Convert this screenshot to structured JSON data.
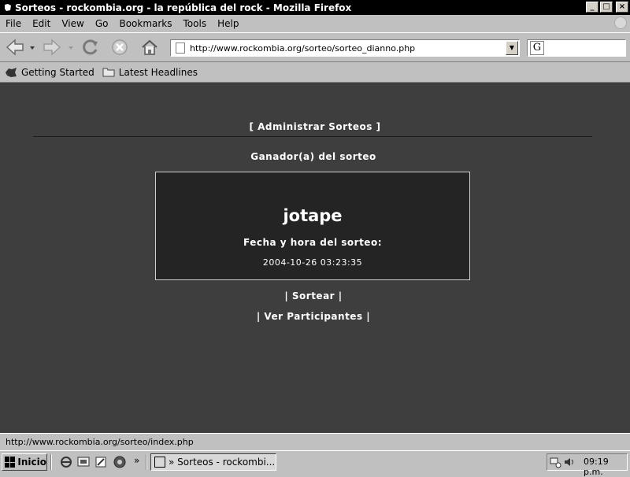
{
  "window": {
    "title": "Sorteos - rockombia.org - la república del rock - Mozilla Firefox",
    "app_glyph": "» ",
    "controls": {
      "minimize": "_",
      "maximize": "□",
      "close": "×"
    }
  },
  "menu": [
    {
      "label": "File"
    },
    {
      "label": "Edit"
    },
    {
      "label": "View"
    },
    {
      "label": "Go"
    },
    {
      "label": "Bookmarks"
    },
    {
      "label": "Tools"
    },
    {
      "label": "Help"
    }
  ],
  "toolbar": {
    "icons": [
      "back-arrow-icon",
      "forward-arrow-icon",
      "reload-icon",
      "stop-icon",
      "home-icon"
    ],
    "url": "http://www.rockombia.org/sorteo/sorteo_dianno.php",
    "search_engine_glyph": "G"
  },
  "bookmarks": [
    {
      "label": "Getting Started",
      "icon": "firefox-bookmark-icon"
    },
    {
      "label": "Latest Headlines",
      "icon": "folder-icon"
    }
  ],
  "page": {
    "admin_link": "[ Administrar Sorteos ]",
    "winner_heading": "Ganador(a) del sorteo",
    "winner_name": "jotape",
    "draw_date_label": "Fecha y hora del sorteo:",
    "draw_date": "2004-10-26 03:23:35",
    "sortear_link": "| Sortear |",
    "participantes_link": "| Ver Participantes |"
  },
  "status": {
    "text": "http://www.rockombia.org/sorteo/index.php"
  },
  "taskbar": {
    "start_label": "Inicio",
    "quicklaunch_more": "»",
    "task_label": "» Sorteos - rockombi...",
    "clock": "09:19 p.m."
  },
  "colors": {
    "page_background": "#3e3e3e",
    "box_background": "#242424",
    "text": "#ffffff",
    "chrome": "#c0c0c0"
  }
}
